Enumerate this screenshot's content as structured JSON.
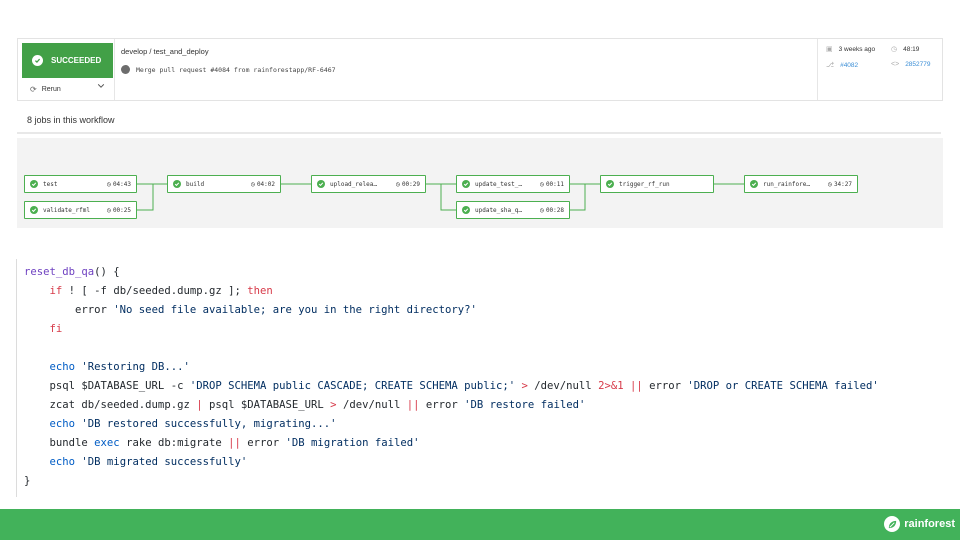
{
  "workflow": {
    "status": "SUCCEEDED",
    "rerun_label": "Rerun",
    "branch": "develop / test_and_deploy",
    "commit_message": "Merge pull request #4084 from rainforestapp/RF-6467",
    "time_ago": "3 weeks ago",
    "duration": "48:19",
    "pr": "#4082",
    "sha": "2852779"
  },
  "jobs": {
    "title": "8 jobs in this workflow",
    "items": [
      {
        "name": "test",
        "time": "04:43"
      },
      {
        "name": "validate_rfml",
        "time": "00:25"
      },
      {
        "name": "build",
        "time": "04:02"
      },
      {
        "name": "upload_relea…",
        "time": "00:29"
      },
      {
        "name": "update_test_…",
        "time": "00:11"
      },
      {
        "name": "update_sha_q…",
        "time": "00:28"
      },
      {
        "name": "trigger_rf_run",
        "time": ""
      },
      {
        "name": "run_rainfore…",
        "time": "34:27"
      }
    ]
  },
  "code": {
    "fn": "reset_db_qa",
    "lines": {
      "if_file": "db/seeded.dump.gz",
      "error1": "'No seed file available; are you in the right directory?'",
      "echo1": "'Restoring DB...'",
      "psql_sql": "'DROP SCHEMA public CASCADE; CREATE SCHEMA public;'",
      "error2": "'DROP or CREATE SCHEMA failed'",
      "error3": "'DB restore failed'",
      "echo2": "'DB restored successfully, migrating...'",
      "error4": "'DB migration failed'",
      "echo3": "'DB migrated successfully'"
    }
  },
  "footer": {
    "brand": "rainforest",
    "color": "#42b25a"
  }
}
